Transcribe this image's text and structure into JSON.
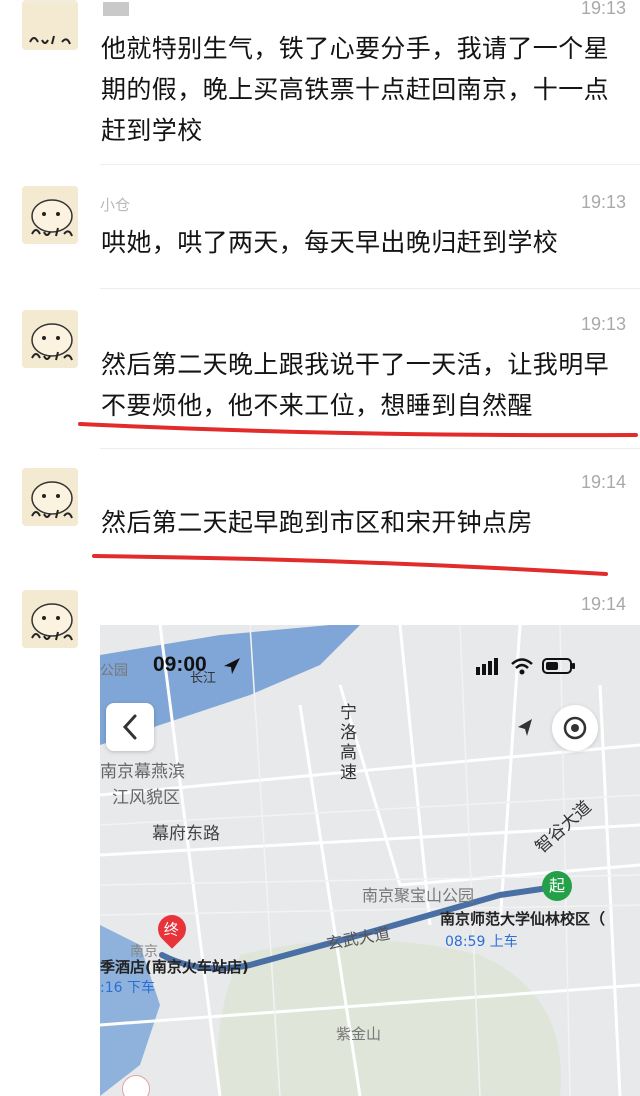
{
  "messages": [
    {
      "time": "19:13",
      "text": "他就特别生气，铁了心要分手，我请了一个星期的假，晚上买高铁票十点赶回南京，十一点赶到学校"
    },
    {
      "sender": "小仓",
      "time": "19:13",
      "text": "哄她，哄了两天，每天早出晚归赶到学校"
    },
    {
      "time": "19:13",
      "text": "然后第二天晚上跟我说干了一天活，让我明早不要烦他，他不来工位，想睡到自然醒"
    },
    {
      "time": "19:14",
      "text": "然后第二天起早跑到市区和宋开钟点房"
    },
    {
      "time": "19:14"
    }
  ],
  "map": {
    "status_time": "09:00",
    "labels": {
      "park_left": "公园",
      "river": "长江",
      "highway_ningluo": "宁洛高速",
      "mufu_yanbin": "南京幕燕滨",
      "jiangfeng": "江风貌区",
      "mufu_road": "幕府东路",
      "zhigu_avenue": "智谷大道",
      "jubao_park": "南京聚宝山公园",
      "xuanwu_avenue": "玄武大道",
      "start_badge": "起",
      "end_badge": "终",
      "start_place": "南京师范大学仙林校区（",
      "start_time": "08:59 上车",
      "end_place": "季酒店(南京火车站店)",
      "end_time": ":16 下车",
      "zijin_mountain": "紫金山",
      "nanjing_partial": "南京"
    },
    "colors": {
      "route": "#4a6fa5",
      "water": "#7fa6d6",
      "start": "#24a148",
      "end": "#e8333a"
    }
  }
}
